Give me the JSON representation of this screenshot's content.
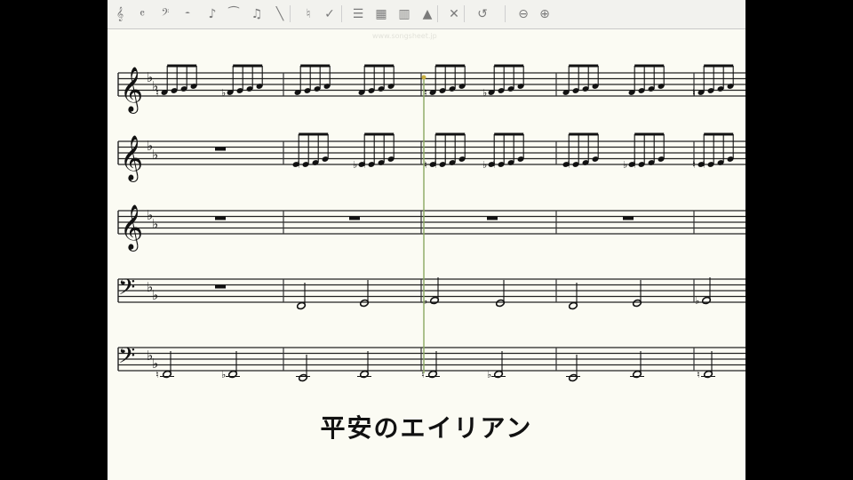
{
  "toolbar": {
    "tools": [
      {
        "name": "treble-clef-tool-icon",
        "glyph": "𝄞"
      },
      {
        "name": "time-signature-tool-icon",
        "glyph": "𝄴"
      },
      {
        "name": "bass-clef-tool-icon",
        "glyph": "𝄢"
      },
      {
        "name": "rest-tool-icon",
        "glyph": "𝄼"
      },
      {
        "name": "note-tool-icon",
        "glyph": "♪"
      },
      {
        "name": "tie-tool-icon",
        "glyph": "⁀"
      },
      {
        "name": "chord-tool-icon",
        "glyph": "♫"
      },
      {
        "name": "flag-tool-icon",
        "glyph": "╲"
      },
      {
        "name": "accidental-tool-icon",
        "glyph": "♮"
      },
      {
        "name": "dynamics-tool-icon",
        "glyph": "✓"
      },
      {
        "name": "staff-tool-icon",
        "glyph": "☰"
      },
      {
        "name": "keyboard-tool-icon",
        "glyph": "▦"
      },
      {
        "name": "mixer-tool-icon",
        "glyph": "▥"
      },
      {
        "name": "accent-tool-icon",
        "glyph": "▲"
      },
      {
        "name": "delete-tool-icon",
        "glyph": "✕"
      },
      {
        "name": "undo-tool-icon",
        "glyph": "↺"
      },
      {
        "name": "zoom-out-icon",
        "glyph": "⊖"
      },
      {
        "name": "zoom-in-icon",
        "glyph": "⊕"
      }
    ]
  },
  "watermark": "www.songsheet.jp",
  "title": "平安のエイリアン",
  "colors": {
    "page": "#fbfbf3",
    "ink": "#111111",
    "cursor": "#8aa860"
  },
  "score": {
    "key": "2 flats",
    "staves": [
      {
        "id": "staff-1",
        "clef": "treble"
      },
      {
        "id": "staff-2",
        "clef": "treble"
      },
      {
        "id": "staff-3",
        "clef": "treble"
      },
      {
        "id": "staff-4",
        "clef": "bass"
      },
      {
        "id": "staff-5",
        "clef": "bass"
      }
    ]
  }
}
